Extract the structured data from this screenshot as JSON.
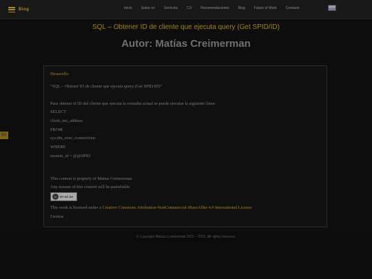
{
  "header": {
    "menu_label": "Blog",
    "nav": [
      "Inicio",
      "Sobre mí",
      "Servicios",
      "CV",
      "Recomendaciones",
      "Blog",
      "Future of Work",
      "Contacto"
    ]
  },
  "page": {
    "title": "SQL – Obtener ID de cliente que ejecuta query (Get SPID/ID)",
    "author_heading": "Autor: Matías Creimerman"
  },
  "side_tab_label": "ES",
  "post": {
    "category": "Desarrollo",
    "lines": [
      "“SQL – Obtener ID de cliente que ejecuta query (Get SPID/ID)”",
      "Para obtener el ID del cliente que ejecuta la consulta actual se puede ejecutar la siguiente línea:",
      "SELECT",
      "client_net_address",
      "FROM",
      "sys.dm_exec_connections",
      "WHERE",
      "session_id = @@SPID",
      "This content is property of Matias Creimerman",
      "Any misuse of this content will be punishable"
    ],
    "cc_badge_label": "BY NC SA",
    "license_prefix": "This work is licensed under a ",
    "license_link": "Creative Commons Attribution-NonCommercial-ShareAlike 4.0 International License",
    "license_link_tail": "License"
  },
  "footer": {
    "copyright": "© Copyright Matías Creimerman 2011 – 2021. All rights reserved."
  }
}
